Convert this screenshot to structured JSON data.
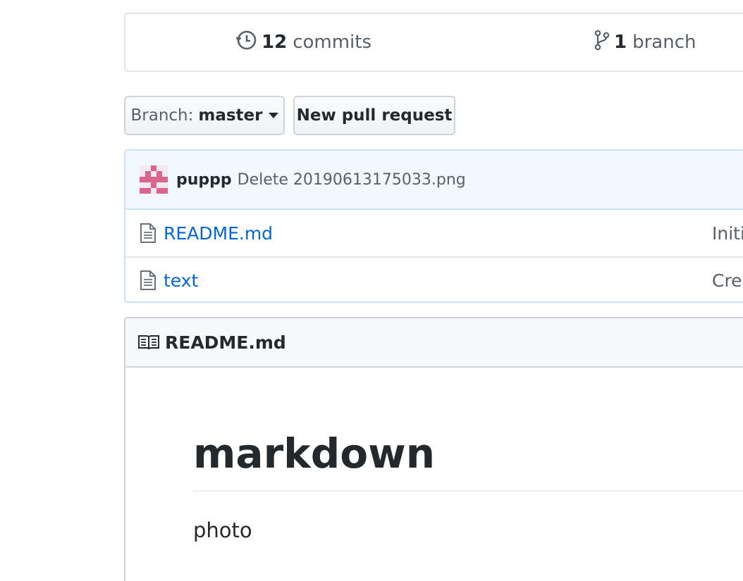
{
  "summary": {
    "commits_count": "12",
    "commits_label": "commits",
    "branch_count": "1",
    "branch_label": "branch"
  },
  "toolbar": {
    "branch_prefix": "Branch:",
    "branch_name": "master",
    "new_pr_label": "New pull request"
  },
  "latest_commit": {
    "author": "puppp",
    "message": "Delete 20190613175033.png"
  },
  "files": [
    {
      "name": "README.md",
      "commit_message": "Initi"
    },
    {
      "name": "text",
      "commit_message": "Crea"
    }
  ],
  "readme": {
    "filename": "README.md",
    "heading": "markdown",
    "paragraph": "photo"
  },
  "colors": {
    "link": "#0366d6",
    "commit_tease_bg": "#f1f8ff",
    "avatar_accent": "#d9648c"
  }
}
